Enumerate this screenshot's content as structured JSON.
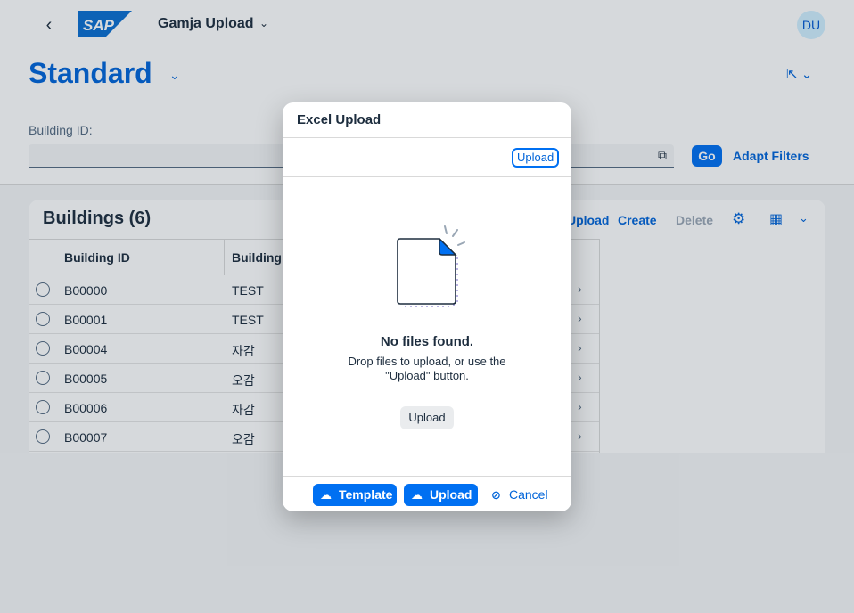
{
  "shell": {
    "back_icon": "chevron-left-icon",
    "logo_text": "SAP",
    "app_title": "Gamja Upload",
    "avatar_initials": "DU"
  },
  "header": {
    "variant": "Standard",
    "share_icon": "share-icon"
  },
  "filterbar": {
    "label": "Building ID:",
    "value": "",
    "go_label": "Go",
    "adapt_label": "Adapt Filters"
  },
  "table": {
    "title": "Buildings (6)",
    "toolbar": {
      "upload_label": "Upload",
      "create_label": "Create",
      "delete_label": "Delete"
    },
    "columns": [
      "Building ID",
      "Building"
    ],
    "rows": [
      {
        "id": "B00000",
        "name": "TEST"
      },
      {
        "id": "B00001",
        "name": "TEST"
      },
      {
        "id": "B00004",
        "name": "자감"
      },
      {
        "id": "B00005",
        "name": "오감"
      },
      {
        "id": "B00006",
        "name": "자감"
      },
      {
        "id": "B00007",
        "name": "오감"
      }
    ]
  },
  "dialog": {
    "title": "Excel Upload",
    "upload_link": "Upload",
    "empty_title": "No files found.",
    "empty_hint": "Drop files to upload, or use the \"Upload\" button.",
    "mid_upload": "Upload",
    "footer": {
      "template_label": "Template",
      "upload_label": "Upload",
      "cancel_label": "Cancel"
    }
  },
  "colors": {
    "brand": "#0070f2",
    "link": "#0064d9",
    "text": "#1d2d3e"
  }
}
